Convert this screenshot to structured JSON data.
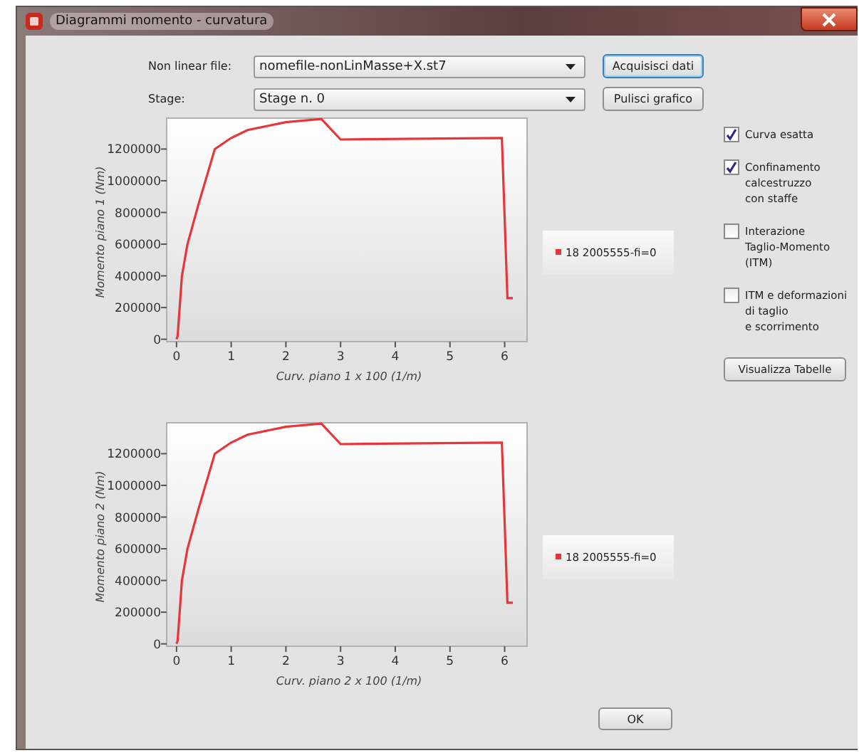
{
  "window": {
    "title": "Diagrammi momento - curvatura"
  },
  "form": [
    {
      "label": "Non linear file:",
      "value": "nomefile-nonLinMasse+X.st7",
      "button": "Acquisisci dati",
      "button_focused": true
    },
    {
      "label": "Stage:",
      "value": "Stage n. 0",
      "button": "Pulisci grafico",
      "button_focused": false
    }
  ],
  "charts": [
    {
      "chart_data": {
        "type": "line",
        "xlabel": "Curv. piano 1 x 100 (1/m)",
        "ylabel": "Momento piano 1 (Nm)",
        "x": [
          0,
          0.02,
          0.1,
          0.2,
          0.4,
          0.7,
          1,
          1.3,
          2,
          2.65,
          3,
          5.95,
          6.05,
          6.15
        ],
        "series": [
          {
            "name": "18 2005555-fi=0",
            "color": "#e8353a",
            "values": [
              0,
              20000,
              400000,
              600000,
              850000,
              1200000,
              1270000,
              1320000,
              1370000,
              1390000,
              1260000,
              1270000,
              260000,
              260000
            ]
          }
        ],
        "xlim": [
          -0.18,
          6.41
        ],
        "ylim": [
          -15000,
          1395000
        ],
        "xticks": [
          0,
          1,
          2,
          3,
          4,
          5,
          6
        ],
        "yticks": [
          0,
          200000,
          400000,
          600000,
          800000,
          1000000,
          1200000
        ]
      }
    },
    {
      "chart_data": {
        "type": "line",
        "xlabel": "Curv. piano 2 x 100 (1/m)",
        "ylabel": "Momento piano 2 (Nm)",
        "x": [
          0,
          0.02,
          0.1,
          0.2,
          0.4,
          0.7,
          1,
          1.3,
          2,
          2.65,
          3,
          5.95,
          6.05,
          6.15
        ],
        "series": [
          {
            "name": "18 2005555-fi=0",
            "color": "#e8353a",
            "values": [
              0,
              20000,
              400000,
              600000,
              850000,
              1200000,
              1270000,
              1320000,
              1370000,
              1390000,
              1260000,
              1270000,
              260000,
              260000
            ]
          }
        ],
        "xlim": [
          -0.18,
          6.41
        ],
        "ylim": [
          -15000,
          1395000
        ],
        "xticks": [
          0,
          1,
          2,
          3,
          4,
          5,
          6
        ],
        "yticks": [
          0,
          200000,
          400000,
          600000,
          800000,
          1000000,
          1200000
        ]
      }
    }
  ],
  "options": [
    {
      "lines": [
        "Curva esatta"
      ],
      "checked": true
    },
    {
      "lines": [
        "Confinamento",
        "calcestruzzo",
        "con staffe"
      ],
      "checked": true
    },
    {
      "lines": [
        "Interazione",
        "Taglio-Momento",
        "(ITM)"
      ],
      "checked": false
    },
    {
      "lines": [
        "ITM e deformazioni",
        "di taglio",
        "e scorrimento"
      ],
      "checked": false
    }
  ],
  "tables_button": "Visualizza Tabelle",
  "ok_button": "OK"
}
